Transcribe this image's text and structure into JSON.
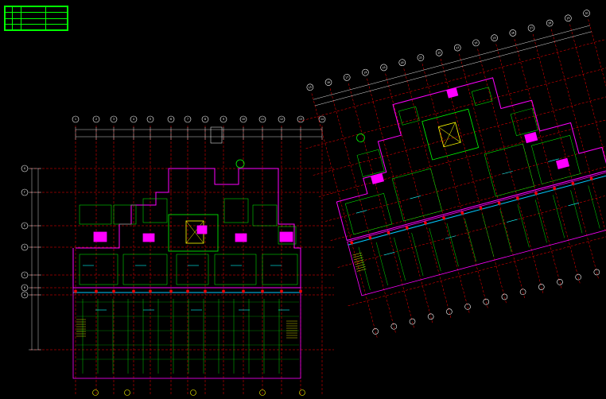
{
  "legend": {
    "rows": [
      [
        "",
        "",
        "",
        ""
      ],
      [
        "",
        "",
        "",
        ""
      ],
      [
        "",
        "",
        "",
        ""
      ],
      [
        "",
        "",
        "",
        ""
      ]
    ]
  },
  "left_plan": {
    "axes_top": [
      "1",
      "2",
      "3",
      "4",
      "5",
      "6",
      "7",
      "8",
      "9",
      "10",
      "11",
      "12",
      "13",
      "14"
    ],
    "axes_side": [
      "G",
      "F",
      "E",
      "D",
      "C",
      "B",
      "A"
    ]
  },
  "right_plan": {
    "axes_top": [
      "15",
      "16",
      "17",
      "18",
      "19",
      "20",
      "21",
      "22",
      "23",
      "24",
      "25",
      "26",
      "27",
      "28",
      "29",
      "30"
    ],
    "axes_side": [
      "G",
      "F",
      "E",
      "D",
      "C",
      "B",
      "A"
    ]
  },
  "colors": {
    "background": "#000000",
    "wall": "#ff00ff",
    "axis": "#ff0000",
    "grid_bubble": "#ffffff",
    "dimension": "#00ffff",
    "furniture": "#00ff00",
    "stair": "#ffff00",
    "window": "#00c8ff"
  }
}
